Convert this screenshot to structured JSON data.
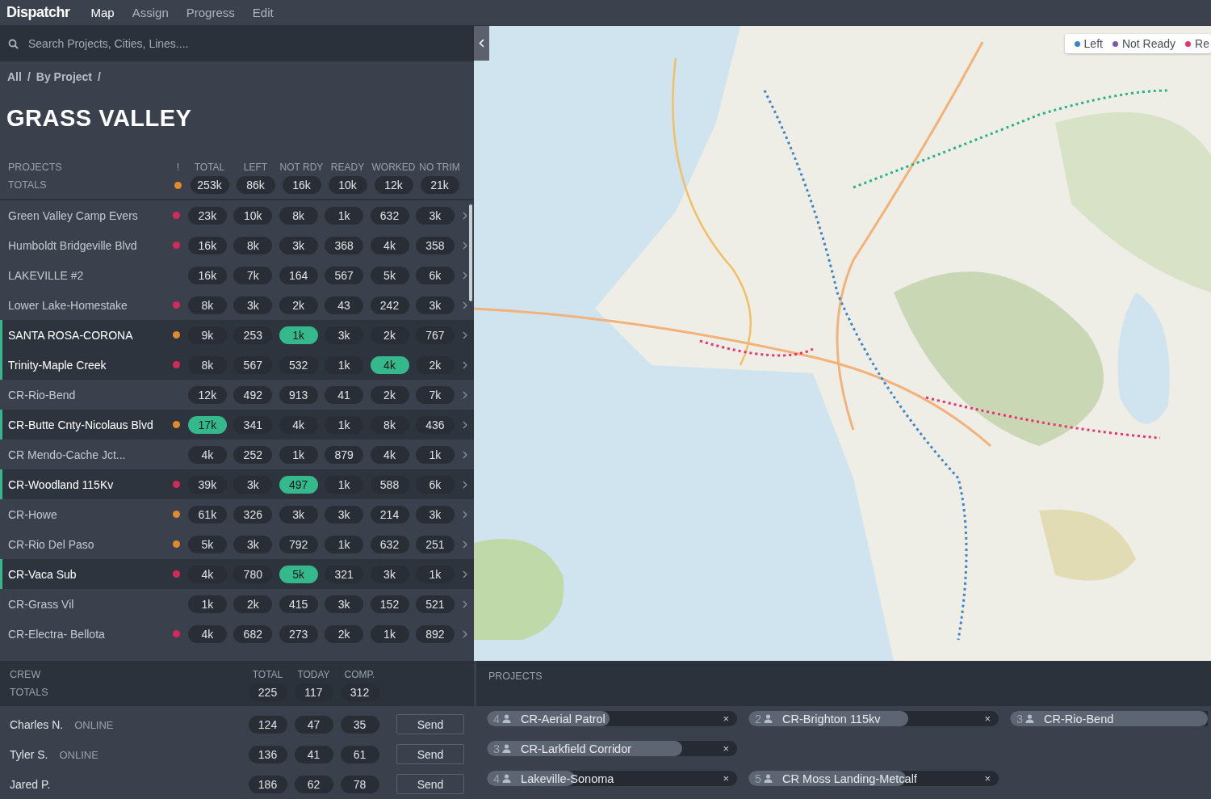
{
  "nav": {
    "logo": "Dispatchr",
    "items": [
      {
        "label": "Map",
        "selected": true
      },
      {
        "label": "Assign",
        "selected": false
      },
      {
        "label": "Progress",
        "selected": false
      },
      {
        "label": "Edit",
        "selected": false
      }
    ]
  },
  "search": {
    "placeholder": "Search Projects, Cities, Lines...."
  },
  "breadcrumb": [
    "All",
    "/",
    "By Project",
    "/"
  ],
  "title": "GRASS VALLEY",
  "projects_table": {
    "label": "PROJECTS",
    "totals_label": "TOTALS",
    "alert_header": "!",
    "columns": [
      "TOTAL",
      "LEFT",
      "NOT RDY",
      "READY",
      "WORKED",
      "NO TRIM"
    ],
    "totals": {
      "color": "#e08a2e",
      "values": [
        "253k",
        "86k",
        "16k",
        "10k",
        "12k",
        "21k"
      ]
    },
    "rows": [
      {
        "name": "Green Valley Camp Evers",
        "selected": false,
        "color": "#d42a5b",
        "values": [
          {
            "text": "23k",
            "highlight": false
          },
          {
            "text": "10k",
            "highlight": false
          },
          {
            "text": "8k",
            "highlight": false
          },
          {
            "text": "1k",
            "highlight": false
          },
          {
            "text": "632",
            "highlight": false
          },
          {
            "text": "3k",
            "highlight": false
          }
        ]
      },
      {
        "name": "Humboldt Bridgeville Blvd",
        "selected": false,
        "color": "#d42a5b",
        "values": [
          {
            "text": "16k",
            "highlight": false
          },
          {
            "text": "8k",
            "highlight": false
          },
          {
            "text": "3k",
            "highlight": false
          },
          {
            "text": "368",
            "highlight": false
          },
          {
            "text": "4k",
            "highlight": false
          },
          {
            "text": "358",
            "highlight": false
          }
        ]
      },
      {
        "name": "LAKEVILLE #2",
        "selected": false,
        "values": [
          {
            "text": "16k",
            "highlight": false
          },
          {
            "text": "7k",
            "highlight": false
          },
          {
            "text": "164",
            "highlight": false
          },
          {
            "text": "567",
            "highlight": false
          },
          {
            "text": "5k",
            "highlight": false
          },
          {
            "text": "6k",
            "highlight": false
          }
        ]
      },
      {
        "name": "Lower Lake-Homestake",
        "selected": false,
        "color": "#d42a5b",
        "values": [
          {
            "text": "8k",
            "highlight": false
          },
          {
            "text": "3k",
            "highlight": false
          },
          {
            "text": "2k",
            "highlight": false
          },
          {
            "text": "43",
            "highlight": false
          },
          {
            "text": "242",
            "highlight": false
          },
          {
            "text": "3k",
            "highlight": false
          }
        ]
      },
      {
        "name": "SANTA ROSA-CORONA",
        "selected": true,
        "color": "#e08a2e",
        "values": [
          {
            "text": "9k",
            "highlight": false
          },
          {
            "text": "253",
            "highlight": false
          },
          {
            "text": "1k",
            "highlight": true
          },
          {
            "text": "3k",
            "highlight": false
          },
          {
            "text": "2k",
            "highlight": false
          },
          {
            "text": "767",
            "highlight": false
          }
        ]
      },
      {
        "name": "Trinity-Maple Creek",
        "selected": true,
        "color": "#d42a5b",
        "values": [
          {
            "text": "8k",
            "highlight": false
          },
          {
            "text": "567",
            "highlight": false
          },
          {
            "text": "532",
            "highlight": false
          },
          {
            "text": "1k",
            "highlight": false
          },
          {
            "text": "4k",
            "highlight": true
          },
          {
            "text": "2k",
            "highlight": false
          }
        ]
      },
      {
        "name": "CR-Rio-Bend",
        "selected": false,
        "values": [
          {
            "text": "12k",
            "highlight": false
          },
          {
            "text": "492",
            "highlight": false
          },
          {
            "text": "913",
            "highlight": false
          },
          {
            "text": "41",
            "highlight": false
          },
          {
            "text": "2k",
            "highlight": false
          },
          {
            "text": "7k",
            "highlight": false
          }
        ]
      },
      {
        "name": "CR-Butte Cnty-Nicolaus Blvd",
        "selected": true,
        "color": "#e08a2e",
        "values": [
          {
            "text": "17k",
            "highlight": true
          },
          {
            "text": "341",
            "highlight": false
          },
          {
            "text": "4k",
            "highlight": false
          },
          {
            "text": "1k",
            "highlight": false
          },
          {
            "text": "8k",
            "highlight": false
          },
          {
            "text": "436",
            "highlight": false
          }
        ]
      },
      {
        "name": "CR Mendo-Cache Jct...",
        "selected": false,
        "values": [
          {
            "text": "4k",
            "highlight": false
          },
          {
            "text": "252",
            "highlight": false
          },
          {
            "text": "1k",
            "highlight": false
          },
          {
            "text": "879",
            "highlight": false
          },
          {
            "text": "4k",
            "highlight": false
          },
          {
            "text": "1k",
            "highlight": false
          }
        ]
      },
      {
        "name": "CR-Woodland 115Kv",
        "selected": true,
        "color": "#d42a5b",
        "values": [
          {
            "text": "39k",
            "highlight": false
          },
          {
            "text": "3k",
            "highlight": false
          },
          {
            "text": "497",
            "highlight": true
          },
          {
            "text": "1k",
            "highlight": false
          },
          {
            "text": "588",
            "highlight": false
          },
          {
            "text": "6k",
            "highlight": false
          }
        ]
      },
      {
        "name": "CR-Howe",
        "selected": false,
        "color": "#e08a2e",
        "values": [
          {
            "text": "61k",
            "highlight": false
          },
          {
            "text": "326",
            "highlight": false
          },
          {
            "text": "3k",
            "highlight": false
          },
          {
            "text": "3k",
            "highlight": false
          },
          {
            "text": "214",
            "highlight": false
          },
          {
            "text": "3k",
            "highlight": false
          }
        ]
      },
      {
        "name": "CR-Rio Del Paso",
        "selected": false,
        "color": "#e08a2e",
        "values": [
          {
            "text": "5k",
            "highlight": false
          },
          {
            "text": "3k",
            "highlight": false
          },
          {
            "text": "792",
            "highlight": false
          },
          {
            "text": "1k",
            "highlight": false
          },
          {
            "text": "632",
            "highlight": false
          },
          {
            "text": "251",
            "highlight": false
          }
        ]
      },
      {
        "name": "CR-Vaca Sub",
        "selected": true,
        "color": "#d42a5b",
        "values": [
          {
            "text": "4k",
            "highlight": false
          },
          {
            "text": "780",
            "highlight": false
          },
          {
            "text": "5k",
            "highlight": true
          },
          {
            "text": "321",
            "highlight": false
          },
          {
            "text": "3k",
            "highlight": false
          },
          {
            "text": "1k",
            "highlight": false
          }
        ]
      },
      {
        "name": "CR-Grass Vil",
        "selected": false,
        "values": [
          {
            "text": "1k",
            "highlight": false
          },
          {
            "text": "2k",
            "highlight": false
          },
          {
            "text": "415",
            "highlight": false
          },
          {
            "text": "3k",
            "highlight": false
          },
          {
            "text": "152",
            "highlight": false
          },
          {
            "text": "521",
            "highlight": false
          }
        ]
      },
      {
        "name": "CR-Electra- Bellota",
        "selected": false,
        "color": "#d42a5b",
        "values": [
          {
            "text": "4k",
            "highlight": false
          },
          {
            "text": "682",
            "highlight": false
          },
          {
            "text": "273",
            "highlight": false
          },
          {
            "text": "2k",
            "highlight": false
          },
          {
            "text": "1k",
            "highlight": false
          },
          {
            "text": "892",
            "highlight": false
          }
        ]
      }
    ]
  },
  "map": {
    "kind": "picture",
    "legend": [
      {
        "label": "Left",
        "color": "#3d85c6"
      },
      {
        "label": "Not Ready",
        "color": "#7a5aa6"
      },
      {
        "label": "Re",
        "color": "#e8336d"
      }
    ]
  },
  "crew_table": {
    "label": "CREW",
    "totals_label": "TOTALS",
    "columns": [
      "TOTAL",
      "TODAY",
      "COMP."
    ],
    "totals": [
      "225",
      "117",
      "312"
    ],
    "rows": [
      {
        "name": "Charles N.",
        "status": "ONLINE",
        "values": [
          "124",
          "47",
          "35"
        ],
        "action": "Send"
      },
      {
        "name": "Tyler S.",
        "status": "ONLINE",
        "values": [
          "136",
          "41",
          "61"
        ],
        "action": "Send"
      },
      {
        "name": "Jared P.",
        "values": [
          "186",
          "62",
          "78"
        ],
        "action": "Send"
      }
    ]
  },
  "projects_panel": {
    "label": "PROJECTS",
    "chip_rows": [
      [
        {
          "count": "4",
          "name": "CR-Aerial Patrol",
          "level": 0.49,
          "close": "×"
        },
        {
          "count": "2",
          "name": "CR-Brighton 115kv",
          "level": 0.64,
          "close": "×"
        },
        {
          "count": "3",
          "name": "CR-Rio-Bend",
          "level": 1
        }
      ],
      [
        {
          "count": "3",
          "name": "CR-Larkfield Corridor",
          "level": 0.78,
          "close": "×"
        }
      ],
      [
        {
          "count": "4",
          "name": "Lakeville-Sonoma",
          "level": 0.35,
          "close": "×"
        },
        {
          "count": "5",
          "name": "CR Moss Landing-Metcalf",
          "level": 0.63,
          "close": "×"
        }
      ]
    ]
  }
}
